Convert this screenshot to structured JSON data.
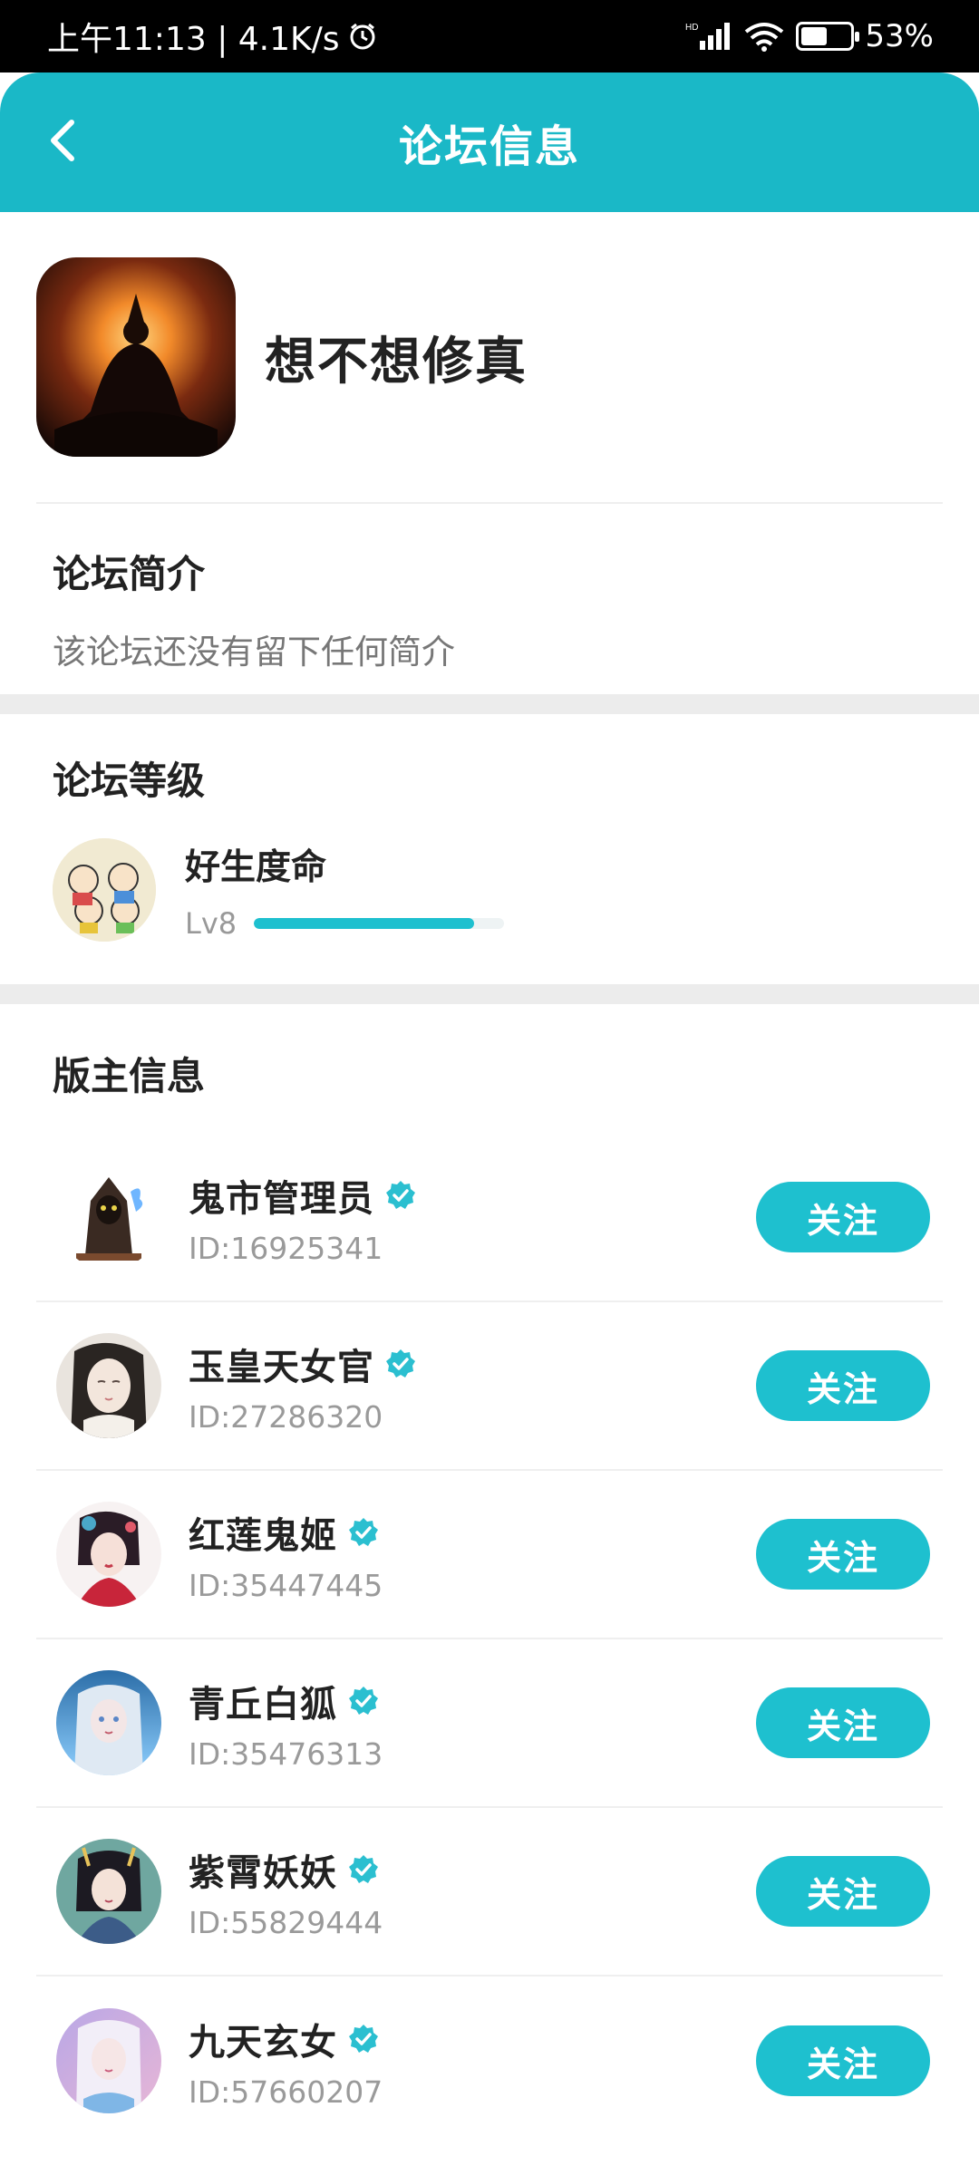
{
  "status_bar": {
    "time": "上午11:13 | 4.1K/s",
    "alarm_icon": "alarm-icon",
    "signal_label": "HD",
    "battery_percent": "53%"
  },
  "header": {
    "title": "论坛信息",
    "back_icon": "chevron-left-icon"
  },
  "forum": {
    "name": "想不想修真"
  },
  "intro": {
    "title": "论坛简介",
    "text": "该论坛还没有留下任何简介"
  },
  "level": {
    "title": "论坛等级",
    "name": "好生度命",
    "lv": "Lv8",
    "progress": 0.88
  },
  "moderators": {
    "title": "版主信息",
    "follow_label": "关注",
    "items": [
      {
        "name": "鬼市管理员",
        "id": "ID:16925341"
      },
      {
        "name": "玉皇天女官",
        "id": "ID:27286320"
      },
      {
        "name": "红莲鬼姬",
        "id": "ID:35447445"
      },
      {
        "name": "青丘白狐",
        "id": "ID:35476313"
      },
      {
        "name": "紫霄妖妖",
        "id": "ID:55829444"
      },
      {
        "name": "九天玄女",
        "id": "ID:57660207"
      }
    ]
  },
  "colors": {
    "accent": "#1ab8c7",
    "button": "#1ec0cf"
  }
}
